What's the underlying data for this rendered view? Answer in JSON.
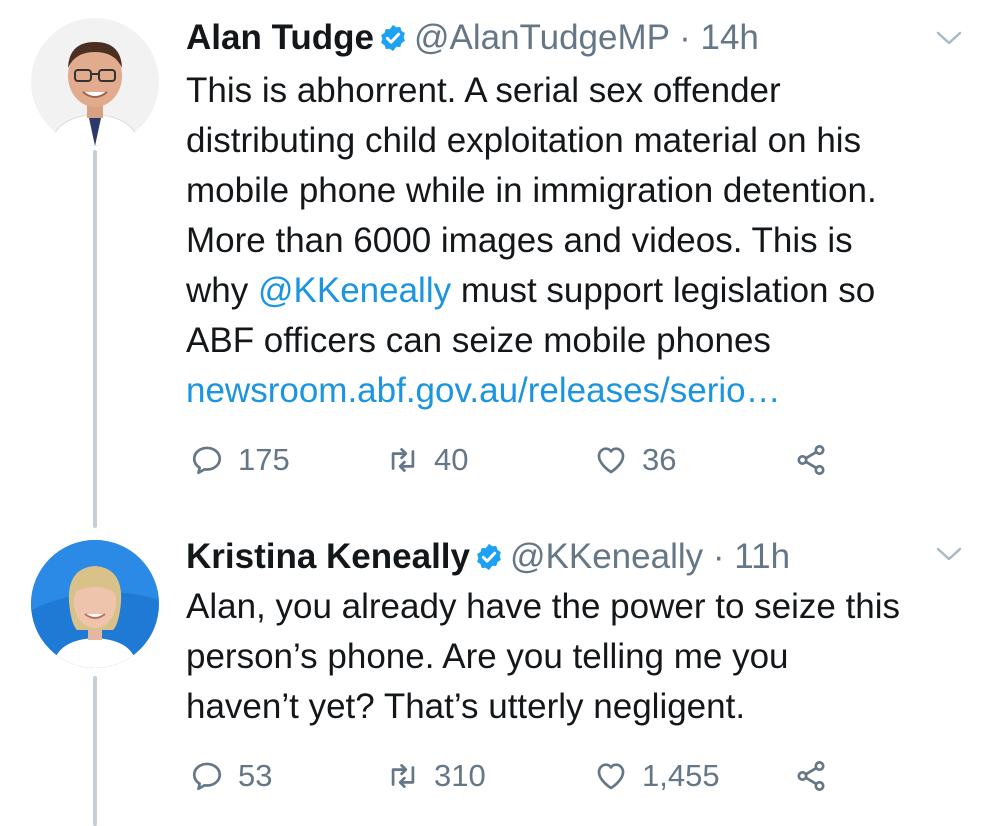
{
  "colors": {
    "text": "#14171a",
    "muted": "#657786",
    "link": "#1b95e0",
    "verified": "#1da1f2",
    "thread": "#c4cfd6"
  },
  "tweets": [
    {
      "name": "Alan Tudge",
      "handle": "@AlanTudgeMP",
      "separator": "·",
      "time": "14h",
      "text_lines": [
        "This is abhorrent. A serial sex offender",
        "distributing child exploitation material on his",
        "mobile phone while in immigration detention.",
        "More than 6000 images and videos. This is"
      ],
      "line5_pre": "why ",
      "mention": "@KKeneally",
      "line5_post": " must support legislation so",
      "line6": "ABF officers can seize mobile phones",
      "link": "newsroom.abf.gov.au/releases/serio…",
      "replies": "175",
      "retweets": "40",
      "likes": "36",
      "icons": {
        "reply": "reply-icon",
        "retweet": "retweet-icon",
        "like": "heart-icon",
        "share": "share-icon",
        "verified": "verified-badge-icon",
        "menu": "chevron-down-icon"
      }
    },
    {
      "name": "Kristina Keneally",
      "handle": "@KKeneally",
      "separator": "·",
      "time": "11h",
      "text_lines": [
        "Alan, you already have the power to seize this",
        "person’s phone. Are you telling me you",
        "haven’t yet? That’s utterly negligent."
      ],
      "replies": "53",
      "retweets": "310",
      "likes": "1,455",
      "icons": {
        "reply": "reply-icon",
        "retweet": "retweet-icon",
        "like": "heart-icon",
        "share": "share-icon",
        "verified": "verified-badge-icon",
        "menu": "chevron-down-icon"
      }
    }
  ]
}
